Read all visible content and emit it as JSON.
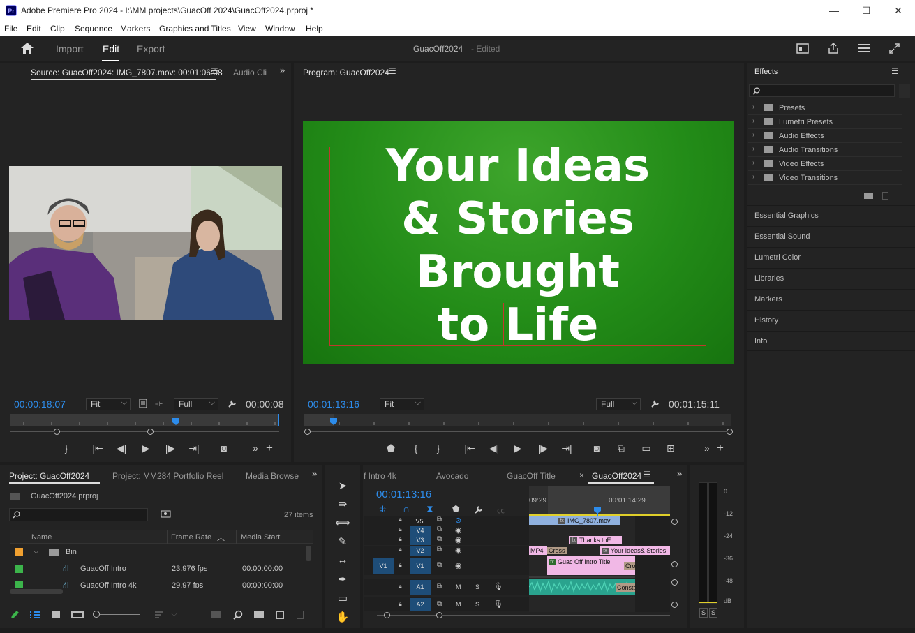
{
  "titlebar": {
    "title": "Adobe Premiere Pro 2024 - I:\\MM projects\\GuacOff 2024\\GuacOff2024.prproj *",
    "logo": "Pr",
    "minimize": "—",
    "maximize": "☐",
    "close": "✕"
  },
  "menu": [
    "File",
    "Edit",
    "Clip",
    "Sequence",
    "Markers",
    "Graphics and Titles",
    "View",
    "Window",
    "Help"
  ],
  "header": {
    "tabs": [
      "Import",
      "Edit",
      "Export"
    ],
    "active_tab": "Edit",
    "project_name": "GuacOff2024",
    "status": "- Edited"
  },
  "source": {
    "tab": "Source: GuacOff2024: IMG_7807.mov: 00:01:06:08",
    "tab2": "Audio Cli",
    "timecode": "00:00:18:07",
    "fit": "Fit",
    "quality": "Full",
    "duration": "00:00:08"
  },
  "program": {
    "tab": "Program: GuacOff2024",
    "title_lines": [
      "Your Ideas",
      "& Stories",
      "Brought",
      "to Life"
    ],
    "timecode": "00:01:13:16",
    "fit": "Fit",
    "quality": "Full",
    "duration": "00:01:15:11"
  },
  "effects": {
    "title": "Effects",
    "search_placeholder": "",
    "items": [
      "Presets",
      "Lumetri Presets",
      "Audio Effects",
      "Audio Transitions",
      "Video Effects",
      "Video Transitions"
    ]
  },
  "right_panels": [
    "Essential Graphics",
    "Essential Sound",
    "Lumetri Color",
    "Libraries",
    "Markers",
    "History",
    "Info"
  ],
  "project": {
    "tabs": [
      "Project: GuacOff2024",
      "Project: MM284 Portfolio Reel",
      "Media Browse"
    ],
    "file": "GuacOff2024.prproj",
    "items_count": "27 items",
    "columns": [
      "Name",
      "Frame Rate",
      "Media Start"
    ],
    "rows": [
      {
        "name": "Bin",
        "fps": "",
        "start": "",
        "color": "#f0a030"
      },
      {
        "name": "GuacOff Intro",
        "fps": "23.976 fps",
        "start": "00:00:00:00",
        "color": "#3cb44b"
      },
      {
        "name": "GuacOff Intro 4k",
        "fps": "29.97 fps",
        "start": "00:00:00:00",
        "color": "#3cb44b"
      }
    ]
  },
  "timeline": {
    "tabs": [
      "f Intro 4k",
      "Avocado",
      "GuacOff Title",
      "GuacOff2024"
    ],
    "active_tab": "GuacOff2024",
    "timecode": "00:01:13:16",
    "ruler": [
      "09:29",
      "00:01:14:29"
    ],
    "tracks": [
      "V5",
      "V4",
      "V3",
      "V2",
      "V1",
      "A1",
      "A2"
    ],
    "source_patch": "V1",
    "clips": {
      "img": "IMG_7807.mov",
      "thanks": "Thanks toE",
      "ideas": "Your Ideas& Stories",
      "intro": "Guac Off Intro Title",
      "mp4": "MP4",
      "cross": "Cross",
      "cro": "Cro",
      "consta": "Consta"
    }
  },
  "meter": {
    "scale": [
      "0",
      "-12",
      "-24",
      "-36",
      "-48",
      "dB"
    ],
    "solo": [
      "S",
      "S"
    ]
  },
  "colors": {
    "accent": "#2d8ceb",
    "program_bg": "#238c18",
    "pink_clip": "#f1b8e6",
    "blue_clip": "#8fb0de",
    "audio": "#2aa38e"
  }
}
